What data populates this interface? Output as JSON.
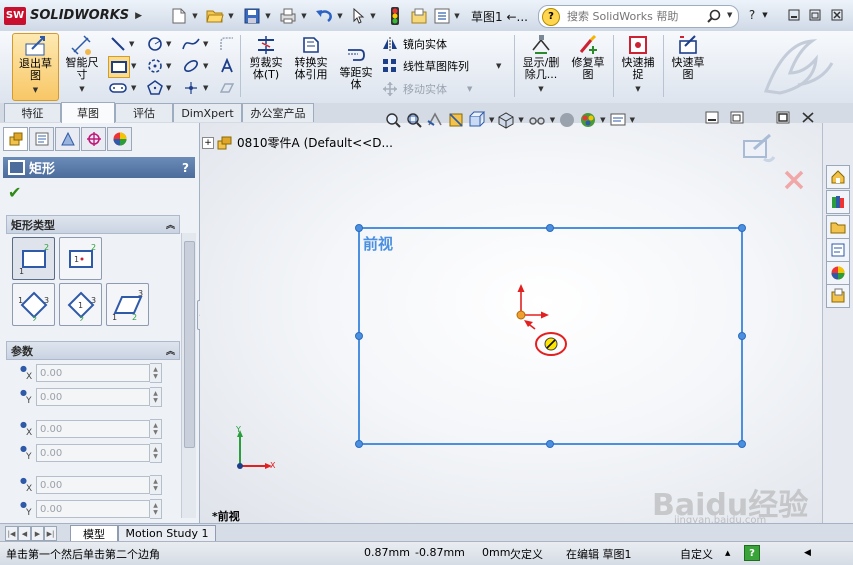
{
  "app": {
    "logo_badge": "SW",
    "logo_text": "SOLIDWORKS",
    "brand_color": "#c8102e"
  },
  "title_bar": {
    "document_title": "草图1 ←...",
    "help_search_placeholder": "搜索 SolidWorks 帮助",
    "help_icon_label": "?",
    "quick_access_icons": [
      "new-document-icon",
      "open-icon",
      "save-icon",
      "print-icon",
      "undo-icon",
      "select-icon",
      "rebuild-icon",
      "file-properties-icon",
      "options-icon"
    ],
    "window_controls": [
      "minimize-icon",
      "restore-icon",
      "close-icon"
    ]
  },
  "command_manager": {
    "exit_sketch": "退出草\n图",
    "smart_dimension": "智能尺\n寸",
    "trim_entities": "剪裁实\n体(T)",
    "convert_entities": "转换实\n体引用",
    "offset_entities": "等距实\n体",
    "mirror_entities": "镜向实体",
    "linear_pattern": "线性草图阵列",
    "move_entities": "移动实体",
    "show_hide_relations": "显示/删\n除几...",
    "repair_sketch": "修复草\n图",
    "quick_snaps": "快速捕\n捉",
    "rapid_sketch": "快速草\n图"
  },
  "tabs": [
    "特征",
    "草图",
    "评估",
    "DimXpert",
    "办公室产品"
  ],
  "active_tab": "草图",
  "left_panel": {
    "property_manager_title": "矩形",
    "help_label": "?",
    "rectangle_type_header": "矩形类型",
    "parameters_header": "参数",
    "coord_label_x": "X",
    "coord_label_y": "Y",
    "coordinates": [
      {
        "axis": "X",
        "value": "0.00"
      },
      {
        "axis": "Y",
        "value": "0.00"
      },
      {
        "axis": "X",
        "value": "0.00"
      },
      {
        "axis": "Y",
        "value": "0.00"
      },
      {
        "axis": "X",
        "value": "0.00"
      },
      {
        "axis": "Y",
        "value": "0.00"
      }
    ]
  },
  "graphics": {
    "feature_tree_root": "0810零件A  (Default<<D...",
    "plane_label": "前视",
    "view_label": "*前视",
    "sketch_color": "#4a8fe0",
    "triad_x": "X",
    "triad_y": "Y"
  },
  "bottom_tabs": [
    "模型",
    "Motion Study 1"
  ],
  "status_bar": {
    "message": "单击第一个然后单击第二个边角",
    "x_coord": "0.87mm",
    "y_coord": "-0.87mm",
    "z_coord": "0mm",
    "sketch_state": "欠定义",
    "editing": "在编辑 草图1",
    "units": "自定义",
    "help_icon": "?"
  },
  "watermark": {
    "text": "Baidu经验",
    "url": "jingyan.baidu.com"
  }
}
